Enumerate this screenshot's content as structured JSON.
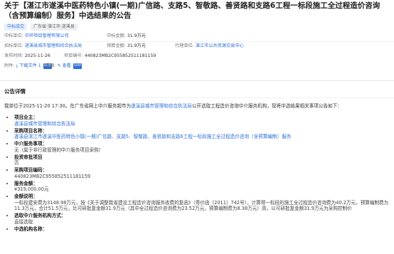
{
  "title": "关于【湛江市遂溪中医药特色小镇(一期)广信路、支路5、智敬路、善贤路和支路6工程一标段施工全过程造价咨询（含预算编制）服务】中选结果的公告",
  "tags": [
    "中标成交",
    "广东省·湛江市·遂溪县"
  ],
  "meta": {
    "winner_label": "中标单位:",
    "winner_value": "中环项目管理有限公司",
    "amount_label": "中标金额:",
    "amount_value": "31.9万元",
    "tenderer_label": "招标单位:",
    "tenderer_value": "遂溪县城市管理和综合执法局",
    "budget_label": "预算金额:",
    "budget_value": "31.9万元",
    "agency_label": "代理单位:",
    "agency_value": "湛江市公共资源交易中心",
    "date_label": "发布时间:",
    "date_value": "2025-11-26",
    "project_no_label": "项目编号:",
    "project_no_value": "440823MB2C955852511181159",
    "attachment_label": "附件:",
    "attachment_value": "下载文件",
    "attachment_count": "1",
    "source_label": "来源:",
    "source_value": "查看",
    "badge_text": "SVIP"
  },
  "section_title": "公告详情",
  "intro": "我单位于2025-11-20 17:30。在广东省网上中介服务超市为遂溪县城市管理和综合执法局公开选取工程造价咨询中介服务机构，现将中选结果相关事项公告如下：",
  "intro_link": "遂溪县城市管理和综合执法局",
  "items": [
    {
      "label": "项目业主：",
      "value": "遂溪县城市管理和综合执法局",
      "link": true
    },
    {
      "label": "采购项目名称：",
      "value": "遂溪县湛江市遂溪中医药特色小镇(一期)广信路、支路5、智敬路、善贤路和支路6工程一标段施工全过程造价咨询（含预算编制）服务",
      "link": true
    },
    {
      "label": "中介服务事项：",
      "value": "无（属于非行政管理的中介服务项目采购）",
      "link": false
    },
    {
      "label": "投资审批项目",
      "value": "否",
      "link": false
    },
    {
      "label": "采购项目编码：",
      "value": "440823MB2C955852511181159",
      "link": false
    },
    {
      "label": "服务金额：",
      "value": "¥319,000.00元",
      "link": false
    },
    {
      "label": "金额说明：",
      "value": "一标段建安费为3148.98万元，按《关于调整我省建设工程造价咨询服务收费的复函》（粤价函〔2011〕742号），计算得一标段的施工全过程造价咨询费为40.2万元，预算编制费为11.3万元，合计51.5万元，比可研批复金额31.9万元（其中全过程造价咨询费为23.52万元，预算编制费为8.38万元）高，以可研批复金额31.9万元为采购控制价",
      "link": false
    },
    {
      "label": "选取中介服务机构方式：",
      "value": "直接选取",
      "link": false
    },
    {
      "label": "中选机构名称：",
      "value": "",
      "link": false
    }
  ]
}
